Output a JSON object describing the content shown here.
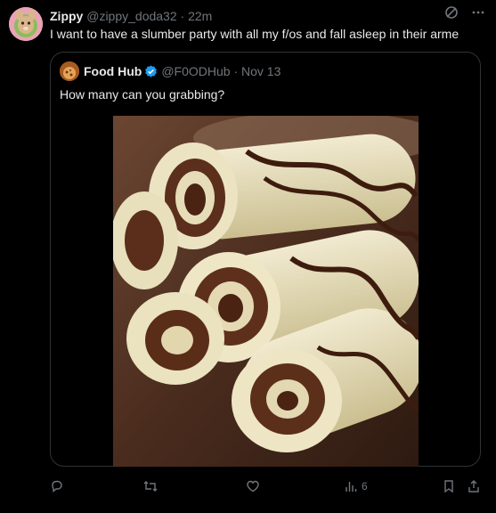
{
  "post": {
    "author_name": "Zippy",
    "author_handle": "@zippy_doda32",
    "separator": "·",
    "time": "22m",
    "text": "I want to have a slumber party with all my f/os and fall asleep in their arme"
  },
  "quoted": {
    "author_name": "Food Hub",
    "author_handle": "@F0ODHub",
    "separator": "·",
    "date": "Nov 13",
    "text": "How many can you grabbing?"
  },
  "actions": {
    "views_count": "6"
  },
  "icons": {
    "grok": "grok-icon",
    "more": "more-icon",
    "verified": "verified-badge-icon",
    "reply": "reply-icon",
    "repost": "repost-icon",
    "like": "like-icon",
    "views": "views-icon",
    "bookmark": "bookmark-icon",
    "share": "share-icon"
  },
  "colors": {
    "background": "#000000",
    "text": "#e7e9ea",
    "muted": "#71767b",
    "border": "#2f3336",
    "verified": "#1d9bf0"
  }
}
